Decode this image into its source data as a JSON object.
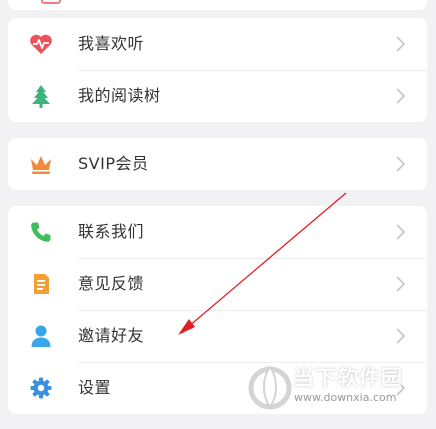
{
  "groups": [
    {
      "items": [
        {
          "label": "我喜欢听",
          "icon": "heart-pulse-icon",
          "icon_color": "#e8545a"
        },
        {
          "label": "我的阅读树",
          "icon": "tree-icon",
          "icon_color": "#3cb47a"
        }
      ]
    },
    {
      "items": [
        {
          "label": "SVIP会员",
          "icon": "crown-icon",
          "icon_color": "#f08a3c"
        }
      ]
    },
    {
      "items": [
        {
          "label": "联系我们",
          "icon": "phone-icon",
          "icon_color": "#3fbf5a"
        },
        {
          "label": "意见反馈",
          "icon": "note-icon",
          "icon_color": "#f2a036"
        },
        {
          "label": "邀请好友",
          "icon": "person-icon",
          "icon_color": "#38a6e8"
        },
        {
          "label": "设置",
          "icon": "gear-icon",
          "icon_color": "#3a8fe0"
        }
      ]
    }
  ],
  "annotation": {
    "color": "#e02020"
  },
  "watermark": {
    "title": "当下软件园",
    "url": "www.downxia.com"
  }
}
